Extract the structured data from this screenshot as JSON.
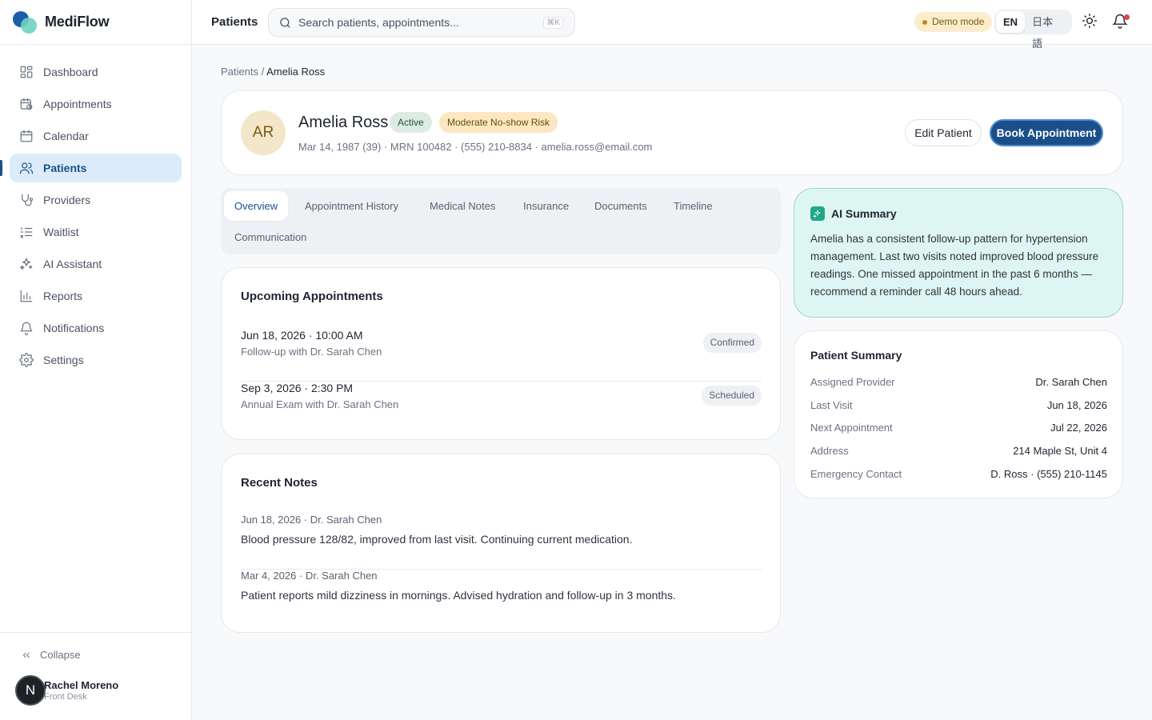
{
  "app": {
    "name": "MediFlow"
  },
  "sidebar": {
    "items": [
      {
        "label": "Dashboard",
        "icon": "dashboard-icon"
      },
      {
        "label": "Appointments",
        "icon": "calendar-clock-icon"
      },
      {
        "label": "Calendar",
        "icon": "calendar-icon"
      },
      {
        "label": "Patients",
        "icon": "users-icon",
        "active": true
      },
      {
        "label": "Providers",
        "icon": "stethoscope-icon"
      },
      {
        "label": "Waitlist",
        "icon": "list-ordered-icon"
      },
      {
        "label": "AI Assistant",
        "icon": "sparkles-icon"
      },
      {
        "label": "Reports",
        "icon": "bar-chart-icon"
      },
      {
        "label": "Notifications",
        "icon": "bell-icon"
      },
      {
        "label": "Settings",
        "icon": "gear-icon"
      }
    ],
    "collapse_label": "Collapse",
    "user": {
      "initial": "N",
      "name": "Rachel Moreno",
      "role": "Front Desk"
    }
  },
  "topbar": {
    "title": "Patients",
    "search_placeholder": "Search patients, appointments...",
    "search_shortcut": "⌘K",
    "demo_label": "Demo mode",
    "languages": [
      "EN",
      "日本語"
    ],
    "selected_language": "EN"
  },
  "breadcrumb": {
    "parent": "Patients",
    "separator": " / ",
    "current": "Amelia Ross"
  },
  "patient": {
    "initials": "AR",
    "name": "Amelia Ross",
    "status": "Active",
    "risk": "Moderate No-show Risk",
    "meta": "Mar 14, 1987 (39) · MRN 100482 · (555) 210-8834 · amelia.ross@email.com",
    "edit_label": "Edit Patient",
    "book_label": "Book Appointment"
  },
  "tabs": [
    "Overview",
    "Appointment History",
    "Medical Notes",
    "Insurance",
    "Documents",
    "Timeline",
    "Communication"
  ],
  "selected_tab": "Overview",
  "upcoming": {
    "title": "Upcoming Appointments",
    "items": [
      {
        "when": "Jun 18, 2026 · 10:00 AM",
        "what": "Follow-up with Dr. Sarah Chen",
        "status": "Confirmed"
      },
      {
        "when": "Sep 3, 2026 · 2:30 PM",
        "what": "Annual Exam with Dr. Sarah Chen",
        "status": "Scheduled"
      }
    ]
  },
  "notes": {
    "title": "Recent Notes",
    "items": [
      {
        "head": "Jun 18, 2026 · Dr. Sarah Chen",
        "body": "Blood pressure 128/82, improved from last visit. Continuing current medication."
      },
      {
        "head": "Mar 4, 2026 · Dr. Sarah Chen",
        "body": "Patient reports mild dizziness in mornings. Advised hydration and follow-up in 3 months."
      }
    ]
  },
  "ai_summary": {
    "title": "AI Summary",
    "text": "Amelia has a consistent follow-up pattern for hypertension management. Last two visits noted improved blood pressure readings. One missed appointment in the past 6 months — recommend a reminder call 48 hours ahead."
  },
  "patient_summary": {
    "title": "Patient Summary",
    "rows": [
      {
        "key": "Assigned Provider",
        "value": "Dr. Sarah Chen"
      },
      {
        "key": "Last Visit",
        "value": "Jun 18, 2026"
      },
      {
        "key": "Next Appointment",
        "value": "Jul 22, 2026"
      },
      {
        "key": "Address",
        "value": "214 Maple St, Unit 4"
      },
      {
        "key": "Emergency Contact",
        "value": "D. Ross · (555) 210-1145"
      }
    ]
  },
  "colors": {
    "brand": "#1b4f8a",
    "accent_teal": "#20a886",
    "risk_bg": "#fbe8c2",
    "active_bg": "#dcece4"
  }
}
